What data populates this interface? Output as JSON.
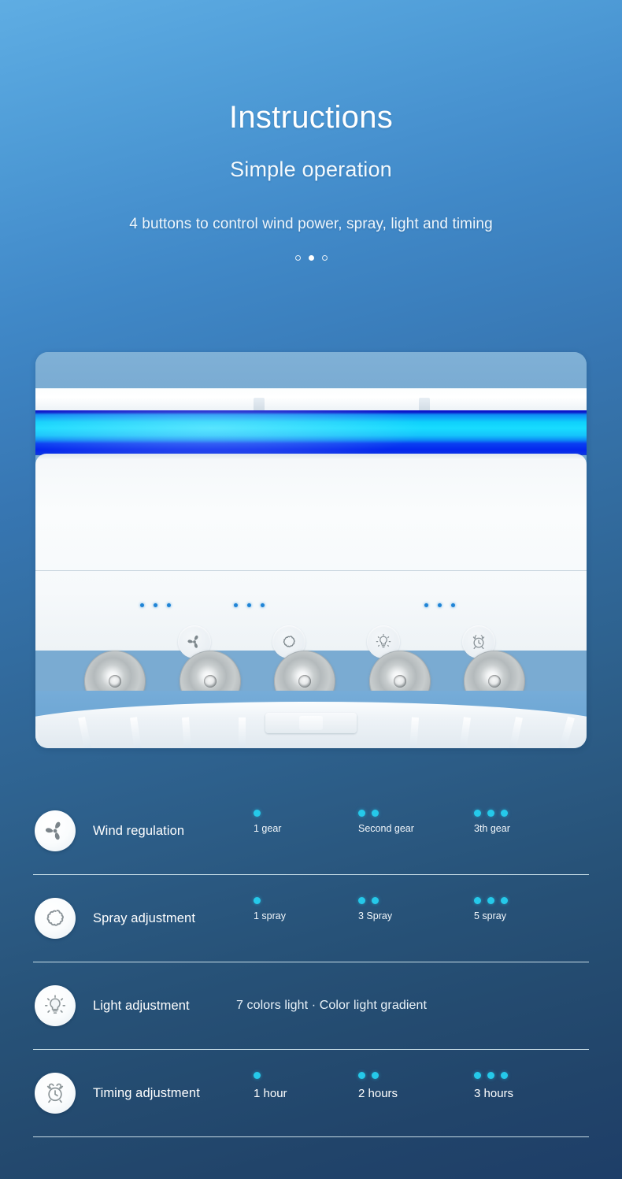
{
  "header": {
    "title": "Instructions",
    "subtitle": "Simple operation",
    "tagline": "4 buttons to control wind power, spray, light and timing"
  },
  "carousel": {
    "dots": [
      "dot-1",
      "dot-2",
      "dot-3"
    ],
    "active_index": 1
  },
  "product_panel": {
    "buttons": [
      {
        "name": "fan-button",
        "icon": "fan-icon"
      },
      {
        "name": "spray-button",
        "icon": "spray-cloud-icon"
      },
      {
        "name": "light-button",
        "icon": "bulb-icon"
      },
      {
        "name": "timer-button",
        "icon": "alarm-clock-icon"
      }
    ],
    "indicator_groups": [
      {
        "for": "fan",
        "count": 3
      },
      {
        "for": "spray",
        "count": 3
      },
      {
        "for": "timer",
        "count": 3
      }
    ],
    "nozzle_count": 5,
    "led_strip_colors": [
      "#0a17c9",
      "#0fd0fb",
      "#18dcff",
      "#0427ee"
    ]
  },
  "features": [
    {
      "icon": "fan-icon",
      "label": "Wind regulation",
      "type": "levels",
      "levels": [
        {
          "dots": 1,
          "label": "1 gear"
        },
        {
          "dots": 2,
          "label": "Second gear"
        },
        {
          "dots": 3,
          "label": "3th gear"
        }
      ]
    },
    {
      "icon": "spray-cloud-icon",
      "label": "Spray adjustment",
      "type": "levels",
      "levels": [
        {
          "dots": 1,
          "label": "1 spray"
        },
        {
          "dots": 2,
          "label": "3 Spray"
        },
        {
          "dots": 3,
          "label": "5 spray"
        }
      ]
    },
    {
      "icon": "bulb-icon",
      "label": "Light adjustment",
      "type": "note",
      "note": "7 colors light · Color light gradient"
    },
    {
      "icon": "alarm-clock-icon",
      "label": "Timing adjustment",
      "type": "levels",
      "emphasis": true,
      "levels": [
        {
          "dots": 1,
          "label": "1 hour"
        },
        {
          "dots": 2,
          "label": "2 hours"
        },
        {
          "dots": 3,
          "label": "3 hours"
        }
      ]
    }
  ],
  "colors": {
    "background_top": "#5fade3",
    "background_bottom": "#1e3e68",
    "accent_dot": "#25c9ea",
    "text_primary": "#ffffff",
    "divider": "#e4f6fa"
  }
}
